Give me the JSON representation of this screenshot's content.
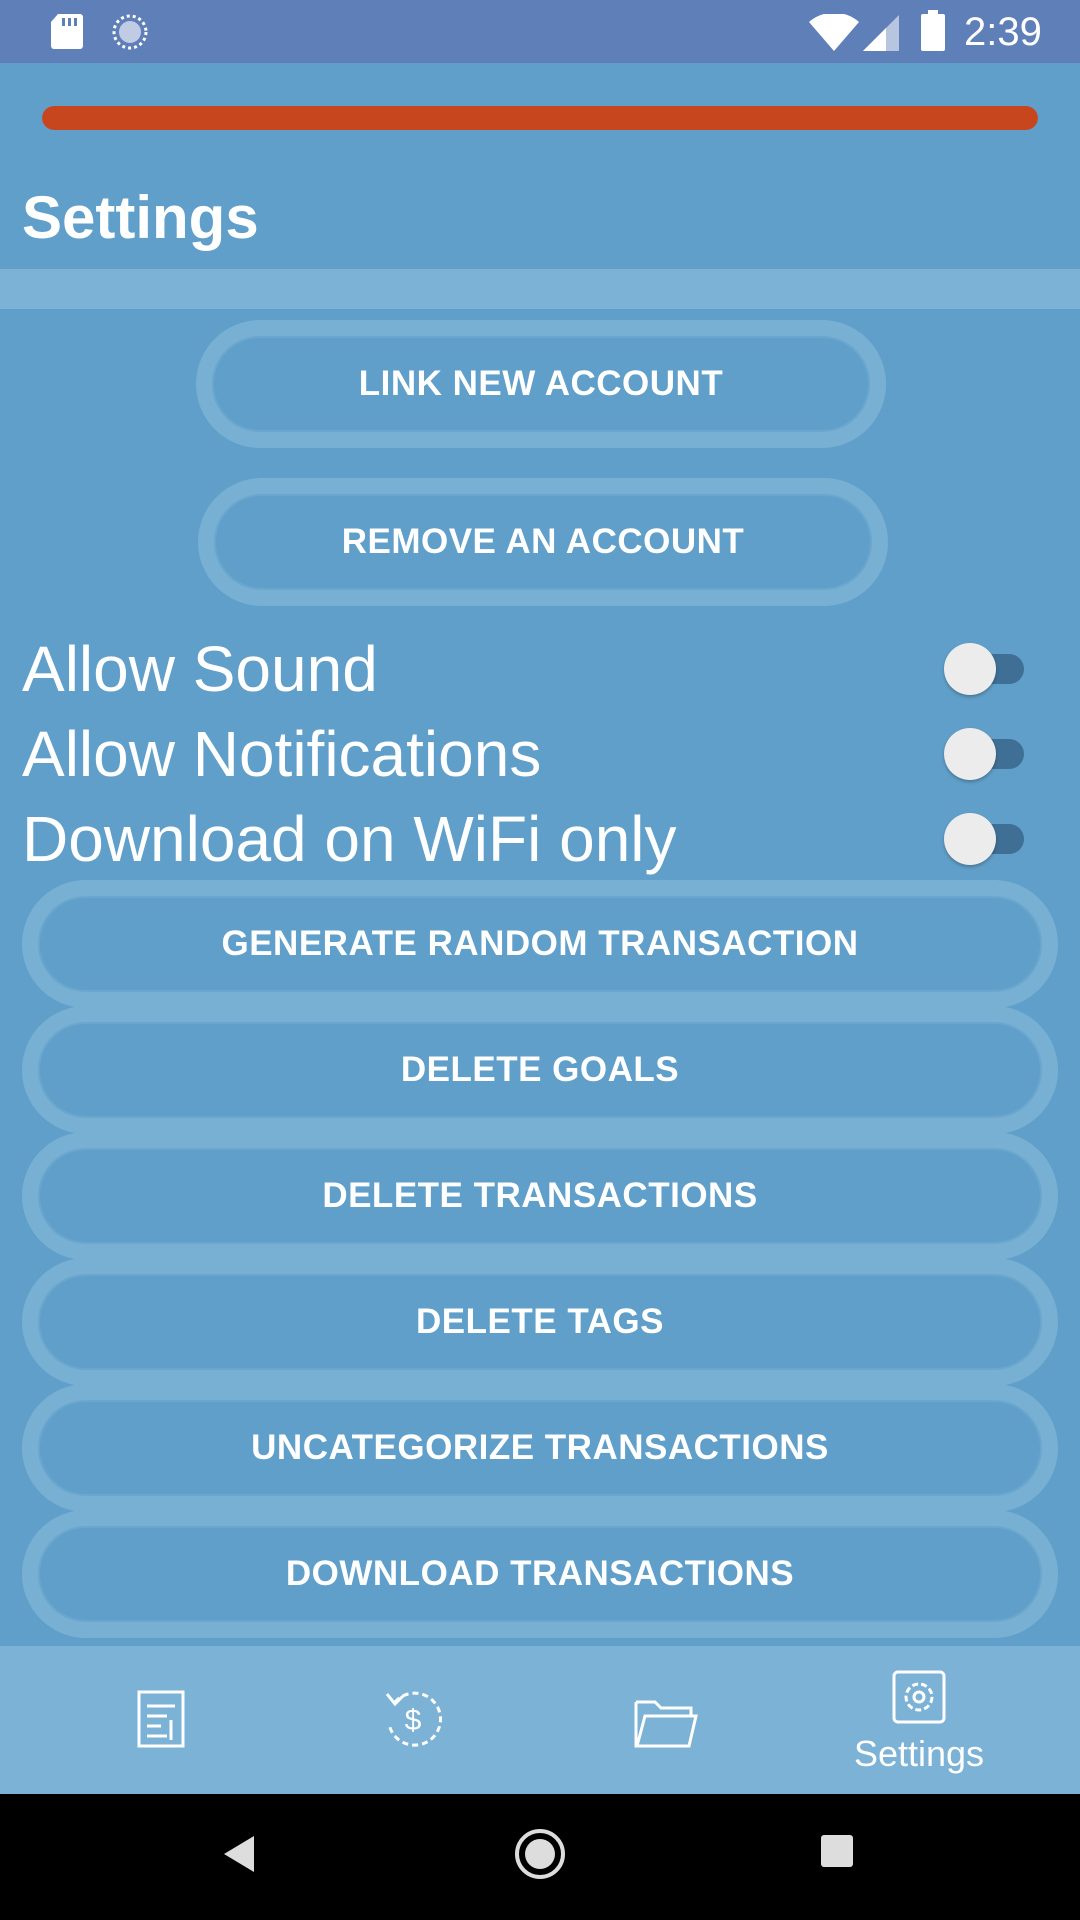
{
  "status_bar": {
    "time": "2:39",
    "icons": [
      "sd-card-icon",
      "sync-icon",
      "wifi-icon",
      "cell-signal-icon",
      "battery-icon"
    ]
  },
  "progress": {
    "value": 1.0,
    "color": "#c8461e"
  },
  "header": {
    "title": "Settings"
  },
  "account_buttons": {
    "link_new": "LINK NEW ACCOUNT",
    "remove": "REMOVE AN ACCOUNT"
  },
  "toggles": [
    {
      "label": "Allow Sound",
      "on": false
    },
    {
      "label": "Allow Notifications",
      "on": false
    },
    {
      "label": "Download on WiFi only",
      "on": false
    }
  ],
  "action_buttons": [
    "GENERATE RANDOM TRANSACTION",
    "DELETE GOALS",
    "DELETE TRANSACTIONS",
    "DELETE TAGS",
    "UNCATEGORIZE TRANSACTIONS",
    "DOWNLOAD TRANSACTIONS"
  ],
  "bottom_nav": {
    "items": [
      {
        "icon": "document-list-icon",
        "label": ""
      },
      {
        "icon": "dollar-history-icon",
        "label": ""
      },
      {
        "icon": "folder-icon",
        "label": ""
      },
      {
        "icon": "gear-icon",
        "label": "Settings"
      }
    ],
    "active": "Settings"
  },
  "colors": {
    "background": "#609fc9",
    "status_bar": "#5f7fb8",
    "accent": "#c8461e",
    "nav_bar": "#7bb2d5"
  }
}
